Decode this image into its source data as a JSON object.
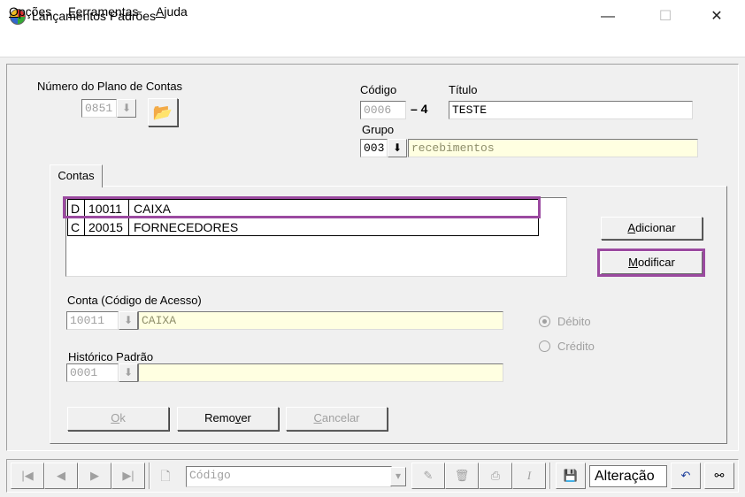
{
  "window": {
    "title": "Lançamentos Padrões",
    "minimize_glyph": "—",
    "maximize_glyph": "☐",
    "close_glyph": "✕"
  },
  "menu": {
    "items": [
      {
        "hotkey": "O",
        "rest": "pções"
      },
      {
        "hotkey": "F",
        "rest": "erramentas"
      },
      {
        "hotkey": "A",
        "rest": "juda"
      }
    ]
  },
  "header": {
    "plan_label": "Número do Plano de Contas",
    "plan_value": "0851",
    "codigo_label": "Código",
    "codigo_value": "0006",
    "dash_number": "– 4",
    "titulo_label": "Título",
    "titulo_value": "TESTE",
    "grupo_label": "Grupo",
    "grupo_code": "003",
    "grupo_name": "recebimentos"
  },
  "tab": {
    "label": "Contas"
  },
  "accounts": [
    {
      "type": "D",
      "code": "10011",
      "name": "CAIXA"
    },
    {
      "type": "C",
      "code": "20015",
      "name": "FORNECEDORES"
    }
  ],
  "buttons": {
    "adicionar_hotkey": "A",
    "adicionar_rest": "dicionar",
    "modificar_hotkey": "M",
    "modificar_rest": "odificar",
    "ok_hotkey": "O",
    "ok_rest": "k",
    "remover_pre": "Remo",
    "remover_hotkey": "v",
    "remover_post": "er",
    "cancelar_hotkey": "C",
    "cancelar_rest": "ancelar"
  },
  "conta": {
    "label": "Conta (Código de Acesso)",
    "code": "10011",
    "name": "CAIXA"
  },
  "historico": {
    "label": "Histórico Padrão",
    "code": "0001",
    "text": ""
  },
  "radio": {
    "debito": "Débito",
    "credito": "Crédito",
    "selected": "Débito"
  },
  "navbar": {
    "first_glyph": "|◀",
    "prev_glyph": "◀",
    "next_glyph": "▶",
    "last_glyph": "▶|",
    "search_field_value": "Código",
    "status": "Alteração"
  },
  "colors": {
    "highlight": "#9b4aa0",
    "field_yellow": "#ffffe1",
    "face": "#f0f0f0"
  }
}
